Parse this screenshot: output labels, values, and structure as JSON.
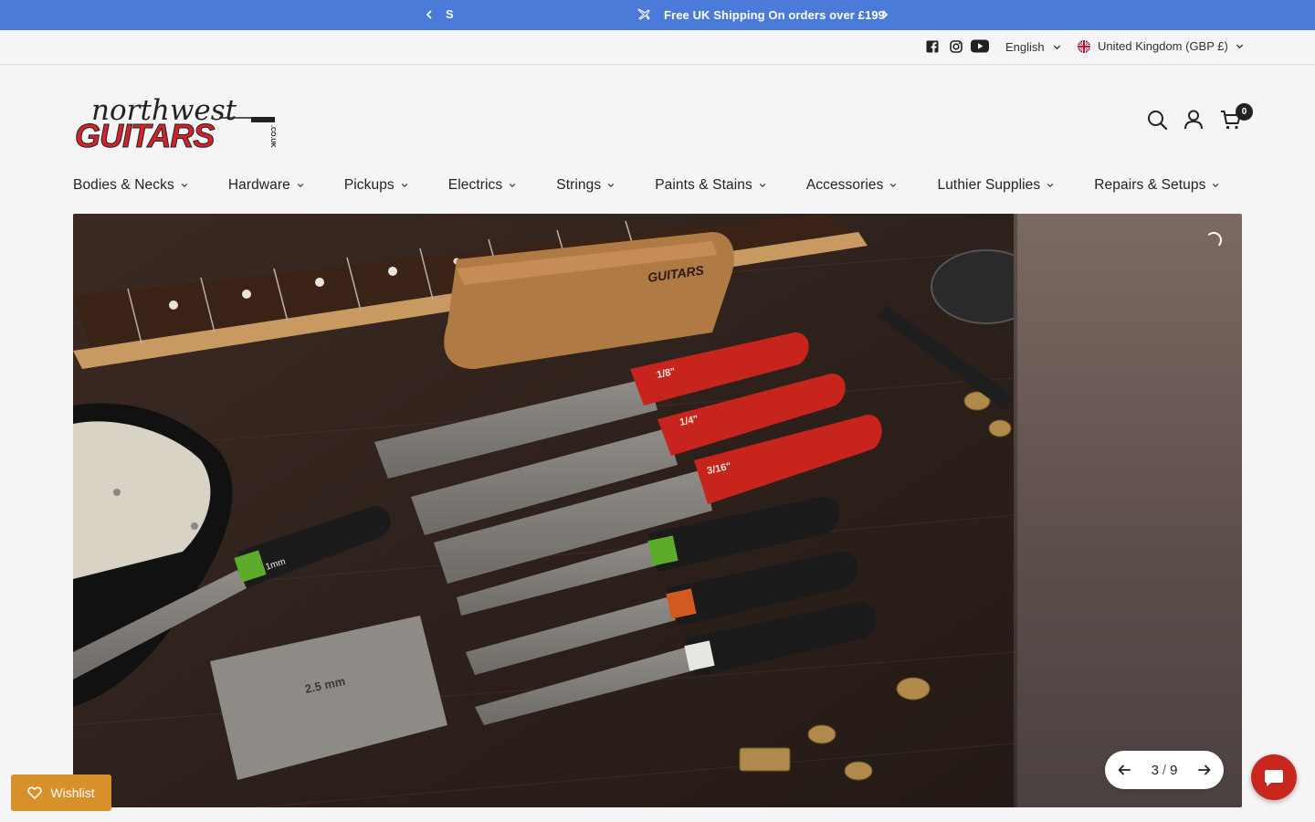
{
  "colors": {
    "announcement_bg": "#4a7bd8",
    "wishlist_bg": "#d7902a",
    "chat_bg": "#c8271f",
    "cart_badge_bg": "#222222"
  },
  "announcement": {
    "previous_fragment": "S",
    "message": "Free UK Shipping On orders over £199"
  },
  "utility": {
    "social_icons": [
      "facebook-icon",
      "instagram-icon",
      "youtube-icon"
    ],
    "language": "English",
    "country": "United Kingdom (GBP £)"
  },
  "header": {
    "logo_top": "northwest",
    "logo_main": "GUITARS",
    "logo_suffix": ".CO.UK",
    "icons": [
      "search-icon",
      "account-icon",
      "cart-icon"
    ],
    "cart_count": "0"
  },
  "nav": {
    "items": [
      {
        "label": "Bodies & Necks"
      },
      {
        "label": "Hardware"
      },
      {
        "label": "Pickups"
      },
      {
        "label": "Electrics"
      },
      {
        "label": "Strings"
      },
      {
        "label": "Paints & Stains"
      },
      {
        "label": "Accessories"
      },
      {
        "label": "Luthier Supplies"
      },
      {
        "label": "Repairs & Setups"
      }
    ]
  },
  "hero": {
    "slide_labels": {
      "file_1": "1/8\"",
      "file_2": "1/4\"",
      "file_3": "3/16\"",
      "feeler_green": "1mm",
      "block": "2.5 mm",
      "brand": "GUITARS"
    },
    "pager": {
      "current": "3",
      "separator": "/",
      "total": "9"
    }
  },
  "wishlist": {
    "label": "Wishlist"
  }
}
